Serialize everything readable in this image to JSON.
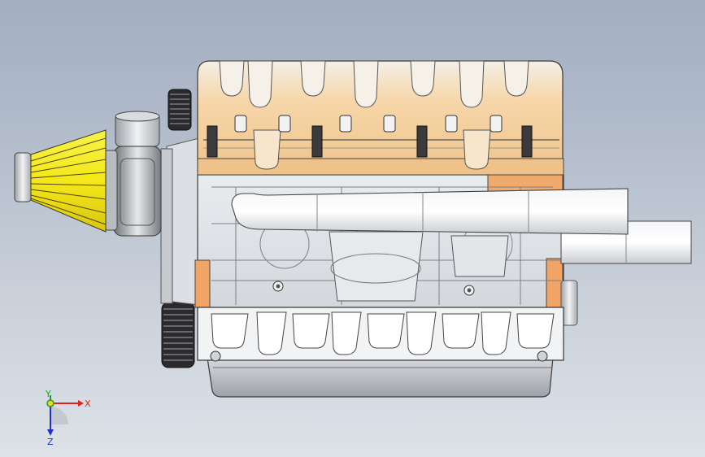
{
  "viewport": {
    "model_icon": "v8-engine-assembly-icon"
  },
  "triad": {
    "x_label": "X",
    "y_label": "Y",
    "z_label": "Z",
    "colors": {
      "x": "#e0241b",
      "y": "#1fa02a",
      "z": "#2330c8",
      "origin": "#f2d21a"
    }
  },
  "colors": {
    "head_tint": "#f5d4a8",
    "filter_yellow": "#f4ee19",
    "block_orange": "#f0a060",
    "metal_light": "#eef0f2",
    "metal_dark": "#8a8d92"
  }
}
